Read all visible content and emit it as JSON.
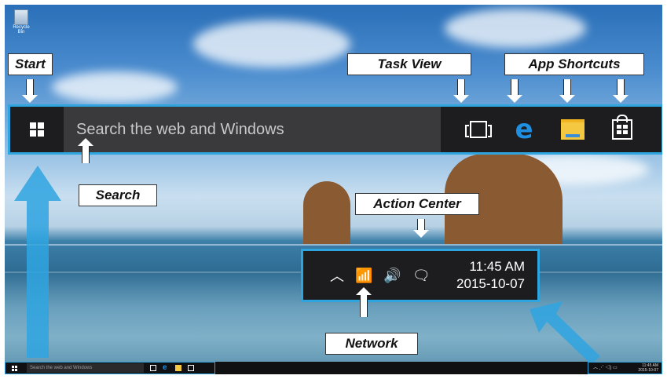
{
  "desktop": {
    "recycle_bin_label": "Recycle Bin"
  },
  "callouts": {
    "start": "Start",
    "search": "Search",
    "task_view": "Task View",
    "app_shortcuts": "App Shortcuts",
    "action_center": "Action Center",
    "network": "Network"
  },
  "taskbar": {
    "search_placeholder": "Search the web and Windows",
    "icons": [
      "windows-logo",
      "task-view",
      "edge",
      "file-explorer",
      "store"
    ]
  },
  "tray": {
    "icons": [
      "chevron-up",
      "network-wifi",
      "volume",
      "action-center"
    ],
    "time": "11:45 AM",
    "date": "2015-10-07"
  },
  "mini_taskbar": {
    "search_placeholder": "Search the web and Windows",
    "time": "11:45 AM",
    "date": "2015-10-07"
  },
  "colors": {
    "highlight": "#2fa5e0",
    "taskbar": "#1d1d1f",
    "edge": "#1e8fe1",
    "folder": "#f5c842"
  }
}
